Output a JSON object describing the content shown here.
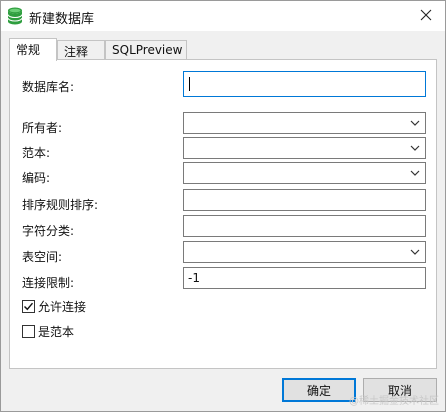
{
  "window": {
    "title": "新建数据库",
    "icon": "database-icon",
    "close_glyph": "✕"
  },
  "tabs": [
    {
      "label": "常规",
      "active": true
    },
    {
      "label": "注释",
      "active": false
    },
    {
      "label": "SQLPreview",
      "active": false
    }
  ],
  "form": {
    "db_name": {
      "label": "数据库名:",
      "value": ""
    },
    "owner": {
      "label": "所有者:",
      "value": ""
    },
    "template": {
      "label": "范本:",
      "value": ""
    },
    "encoding": {
      "label": "编码:",
      "value": ""
    },
    "collation": {
      "label": "排序规则排序:",
      "value": ""
    },
    "ctype": {
      "label": "字符分类:",
      "value": ""
    },
    "tablespace": {
      "label": "表空间:",
      "value": ""
    },
    "conn_limit": {
      "label": "连接限制:",
      "value": "-1"
    },
    "allow_conn": {
      "label": "允许连接",
      "checked": true
    },
    "is_template": {
      "label": "是范本",
      "checked": false
    }
  },
  "buttons": {
    "ok": "确定",
    "cancel": "取消"
  },
  "watermark": "@稀土掘金技术社区",
  "colors": {
    "accent": "#0078d7",
    "db_icon": "#2e9e3e"
  }
}
